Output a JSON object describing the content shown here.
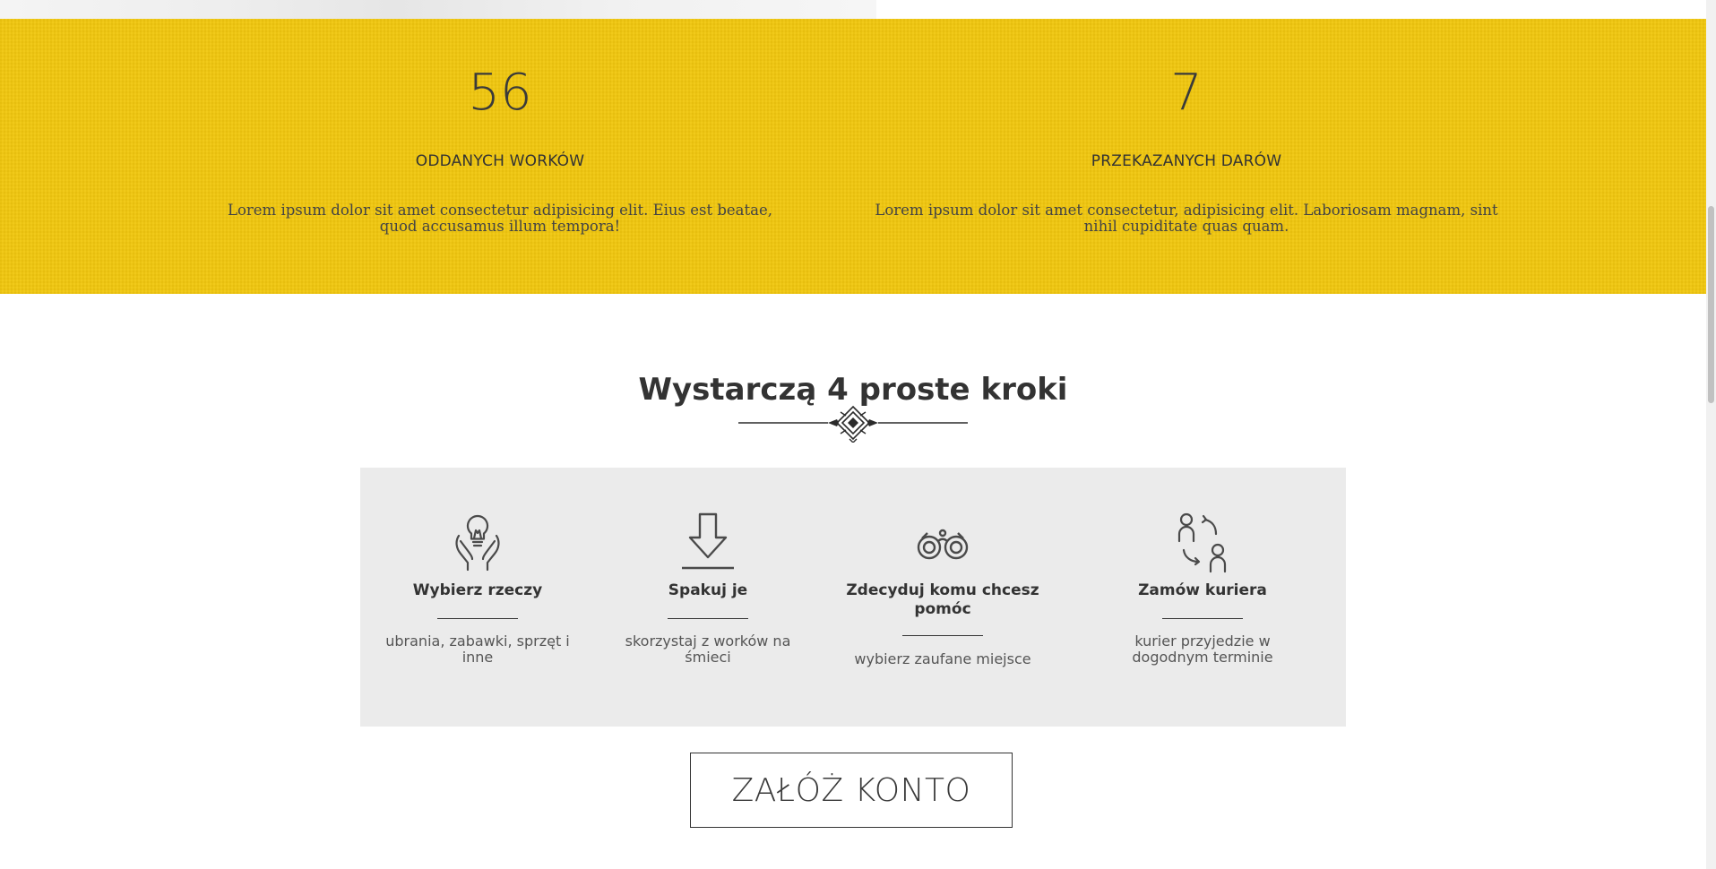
{
  "stats": [
    {
      "number": "56",
      "label": "ODDANYCH WORKÓW",
      "description": "Lorem ipsum dolor sit amet consectetur adipisicing elit. Eius est beatae, quod accusamus illum tempora!"
    },
    {
      "number": "7",
      "label": "PRZEKAZANYCH DARÓW",
      "description": "Lorem ipsum dolor sit amet consectetur, adipisicing elit. Laboriosam magnam, sint nihil cupiditate quas quam."
    }
  ],
  "steps_section": {
    "title": "Wystarczą 4 proste kroki",
    "steps": [
      {
        "icon": "hands-lightbulb-icon",
        "title": "Wybierz rzeczy",
        "subtitle": "ubrania, zabawki, sprzęt i inne"
      },
      {
        "icon": "download-arrow-icon",
        "title": "Spakuj je",
        "subtitle": "skorzystaj z worków na śmieci"
      },
      {
        "icon": "binoculars-icon",
        "title": "Zdecyduj komu chcesz pomóc",
        "subtitle": "wybierz zaufane miejsce"
      },
      {
        "icon": "people-exchange-icon",
        "title": "Zamów kuriera",
        "subtitle": "kurier przyjedzie w dogodnym terminie"
      }
    ]
  },
  "cta": {
    "label": "ZAŁÓŻ KONTO"
  },
  "colors": {
    "stats_background": "#f1c70e",
    "panel_background": "#ebebeb",
    "text_dark": "#333333"
  }
}
